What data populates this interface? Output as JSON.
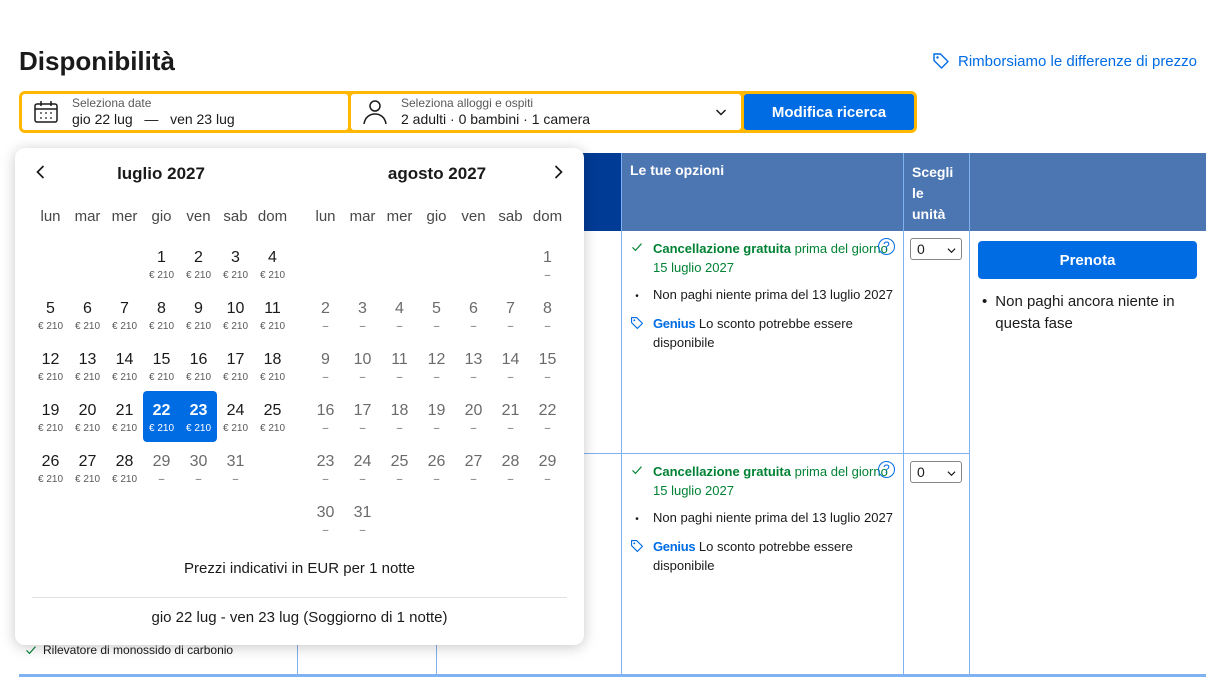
{
  "header": {
    "title": "Disponibilità",
    "refund_link": "Rimborsiamo le differenze di prezzo"
  },
  "search": {
    "date_label": "Seleziona date",
    "date_checkin": "gio 22 lug",
    "date_sep": "—",
    "date_checkout": "ven 23 lug",
    "guests_label": "Seleziona alloggi e ospiti",
    "guests_value": "2 adulti · 0 bambini · 1 camera",
    "button": "Modifica ricerca"
  },
  "table": {
    "header_options": "Le tue opzioni",
    "header_units": "Scegli le unità",
    "options": [
      {
        "cancel_bold": "Cancellazione gratuita",
        "cancel_rest": " prima del giorno 15 luglio 2027",
        "pay": "Non paghi niente prima del 13 luglio 2027",
        "genius": "Genius",
        "genius_text": " Lo sconto potrebbe essere disponibile",
        "help": "?",
        "units": "0"
      },
      {
        "cancel_bold": "Cancellazione gratuita",
        "cancel_rest": " prima del giorno 15 luglio 2027",
        "pay": "Non paghi niente prima del 13 luglio 2027",
        "genius": "Genius",
        "genius_text": " Lo sconto potrebbe essere disponibile",
        "help": "?",
        "units": "0"
      }
    ],
    "book_button": "Prenota",
    "book_note": "Non paghi ancora niente in questa fase",
    "feature": "Rilevatore di monossido di carbonio"
  },
  "calendar": {
    "weekdays": [
      "lun",
      "mar",
      "mer",
      "gio",
      "ven",
      "sab",
      "dom"
    ],
    "months": [
      {
        "title": "luglio 2027",
        "weeks": [
          [
            [
              "",
              ""
            ],
            [
              "",
              ""
            ],
            [
              "",
              ""
            ],
            [
              "1",
              "€ 210"
            ],
            [
              "2",
              "€ 210"
            ],
            [
              "3",
              "€ 210"
            ],
            [
              "4",
              "€ 210"
            ]
          ],
          [
            [
              "5",
              "€ 210"
            ],
            [
              "6",
              "€ 210"
            ],
            [
              "7",
              "€ 210"
            ],
            [
              "8",
              "€ 210"
            ],
            [
              "9",
              "€ 210"
            ],
            [
              "10",
              "€ 210"
            ],
            [
              "11",
              "€ 210"
            ]
          ],
          [
            [
              "12",
              "€ 210"
            ],
            [
              "13",
              "€ 210"
            ],
            [
              "14",
              "€ 210"
            ],
            [
              "15",
              "€ 210"
            ],
            [
              "16",
              "€ 210"
            ],
            [
              "17",
              "€ 210"
            ],
            [
              "18",
              "€ 210"
            ]
          ],
          [
            [
              "19",
              "€ 210"
            ],
            [
              "20",
              "€ 210"
            ],
            [
              "21",
              "€ 210"
            ],
            [
              "22",
              "€ 210",
              "start"
            ],
            [
              "23",
              "€ 210",
              "end"
            ],
            [
              "24",
              "€ 210"
            ],
            [
              "25",
              "€ 210"
            ]
          ],
          [
            [
              "26",
              "€ 210"
            ],
            [
              "27",
              "€ 210"
            ],
            [
              "28",
              "€ 210"
            ],
            [
              "29",
              "–",
              "muted"
            ],
            [
              "30",
              "–",
              "muted"
            ],
            [
              "31",
              "–",
              "muted"
            ],
            [
              "",
              ""
            ]
          ]
        ]
      },
      {
        "title": "agosto 2027",
        "weeks": [
          [
            [
              "",
              ""
            ],
            [
              "",
              ""
            ],
            [
              "",
              ""
            ],
            [
              "",
              ""
            ],
            [
              "",
              ""
            ],
            [
              "",
              ""
            ],
            [
              "1",
              "–",
              "muted"
            ]
          ],
          [
            [
              "2",
              "–",
              "muted"
            ],
            [
              "3",
              "–",
              "muted"
            ],
            [
              "4",
              "–",
              "muted"
            ],
            [
              "5",
              "–",
              "muted"
            ],
            [
              "6",
              "–",
              "muted"
            ],
            [
              "7",
              "–",
              "muted"
            ],
            [
              "8",
              "–",
              "muted"
            ]
          ],
          [
            [
              "9",
              "–",
              "muted"
            ],
            [
              "10",
              "–",
              "muted"
            ],
            [
              "11",
              "–",
              "muted"
            ],
            [
              "12",
              "–",
              "muted"
            ],
            [
              "13",
              "–",
              "muted"
            ],
            [
              "14",
              "–",
              "muted"
            ],
            [
              "15",
              "–",
              "muted"
            ]
          ],
          [
            [
              "16",
              "–",
              "muted"
            ],
            [
              "17",
              "–",
              "muted"
            ],
            [
              "18",
              "–",
              "muted"
            ],
            [
              "19",
              "–",
              "muted"
            ],
            [
              "20",
              "–",
              "muted"
            ],
            [
              "21",
              "–",
              "muted"
            ],
            [
              "22",
              "–",
              "muted"
            ]
          ],
          [
            [
              "23",
              "–",
              "muted"
            ],
            [
              "24",
              "–",
              "muted"
            ],
            [
              "25",
              "–",
              "muted"
            ],
            [
              "26",
              "–",
              "muted"
            ],
            [
              "27",
              "–",
              "muted"
            ],
            [
              "28",
              "–",
              "muted"
            ],
            [
              "29",
              "–",
              "muted"
            ]
          ],
          [
            [
              "30",
              "–",
              "muted"
            ],
            [
              "31",
              "–",
              "muted"
            ],
            [
              "",
              ""
            ],
            [
              "",
              ""
            ],
            [
              "",
              ""
            ],
            [
              "",
              ""
            ],
            [
              "",
              ""
            ]
          ]
        ]
      }
    ],
    "price_note": "Prezzi indicativi in EUR per 1 notte",
    "stay_summary": "gio 22 lug - ven 23 lug (Soggiorno di 1 notte)"
  },
  "colors": {
    "accent": "#006ce4",
    "search_border": "#ffb700",
    "table_header": "#4c76b2",
    "success": "#008234"
  }
}
